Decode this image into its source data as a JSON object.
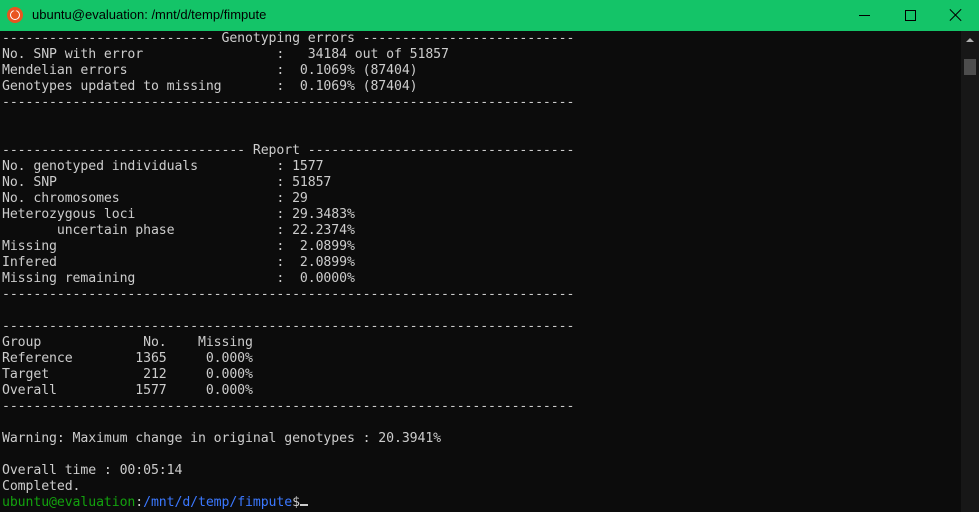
{
  "window": {
    "title": "ubuntu@evaluation: /mnt/d/temp/fimpute",
    "app_icon": "ubuntu-icon",
    "controls": {
      "minimize": "minimize-icon",
      "maximize": "maximize-icon",
      "close": "close-icon"
    },
    "titlebar_color": "#14c468"
  },
  "terminal": {
    "lines": [
      {
        "kind": "text",
        "text": "--------------------------- Genotyping errors ---------------------------"
      },
      {
        "kind": "text",
        "text": "No. SNP with error                 :   34184 out of 51857"
      },
      {
        "kind": "text",
        "text": "Mendelian errors                   :  0.1069% (87404)"
      },
      {
        "kind": "text",
        "text": "Genotypes updated to missing       :  0.1069% (87404)"
      },
      {
        "kind": "text",
        "text": "-------------------------------------------------------------------------"
      },
      {
        "kind": "text",
        "text": ""
      },
      {
        "kind": "text",
        "text": ""
      },
      {
        "kind": "text",
        "text": "------------------------------- Report ----------------------------------"
      },
      {
        "kind": "text",
        "text": "No. genotyped individuals          : 1577"
      },
      {
        "kind": "text",
        "text": "No. SNP                            : 51857"
      },
      {
        "kind": "text",
        "text": "No. chromosomes                    : 29"
      },
      {
        "kind": "text",
        "text": "Heterozygous loci                  : 29.3483%"
      },
      {
        "kind": "text",
        "text": "       uncertain phase             : 22.2374%"
      },
      {
        "kind": "text",
        "text": "Missing                            :  2.0899%"
      },
      {
        "kind": "text",
        "text": "Infered                            :  2.0899%"
      },
      {
        "kind": "text",
        "text": "Missing remaining                  :  0.0000%"
      },
      {
        "kind": "text",
        "text": "-------------------------------------------------------------------------"
      },
      {
        "kind": "text",
        "text": ""
      },
      {
        "kind": "text",
        "text": "-------------------------------------------------------------------------"
      },
      {
        "kind": "text",
        "text": "Group             No.    Missing"
      },
      {
        "kind": "text",
        "text": "Reference        1365     0.000%"
      },
      {
        "kind": "text",
        "text": "Target            212     0.000%"
      },
      {
        "kind": "text",
        "text": "Overall          1577     0.000%"
      },
      {
        "kind": "text",
        "text": "-------------------------------------------------------------------------"
      },
      {
        "kind": "text",
        "text": ""
      },
      {
        "kind": "text",
        "text": "Warning: Maximum change in original genotypes : 20.3941%"
      },
      {
        "kind": "text",
        "text": ""
      },
      {
        "kind": "text",
        "text": "Overall time : 00:05:14"
      },
      {
        "kind": "text",
        "text": "Completed."
      }
    ],
    "prompt": {
      "user_host": "ubuntu@evaluation",
      "separator": ":",
      "path": "/mnt/d/temp/fimpute",
      "symbol": "$"
    },
    "colors": {
      "text": "#cccccc",
      "user": "#13a10e",
      "path": "#3b78ff",
      "background": "#0c0c0c"
    }
  },
  "scrollbar": {
    "up_icon": "scroll-up-arrow-icon"
  }
}
